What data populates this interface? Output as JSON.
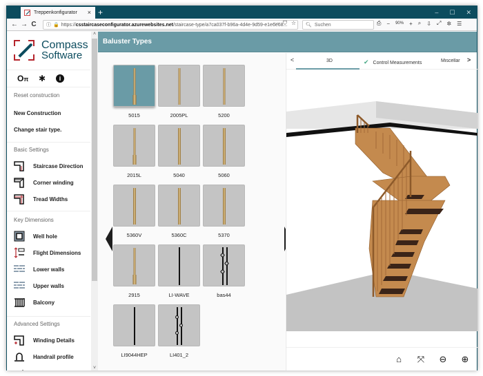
{
  "browser": {
    "tab_title": "Treppenkonfigurator",
    "tab_close": "×",
    "new_tab": "+",
    "window_controls": [
      "–",
      "☐",
      "✕"
    ],
    "nav": {
      "back": "←",
      "forward": "→",
      "reload": "C"
    },
    "url_host": "csstaircaseconfigurator.azurewebsites.net",
    "url_prefix": "https://",
    "url_path": "/staircase-type/a7ca037f-b96a-4d4e-9d59-e1e6e68...",
    "url_icons": [
      "···",
      "pocket-icon",
      "star-icon"
    ],
    "search_placeholder": "Suchen",
    "zoom_level": "90%",
    "toolbar_icons": [
      "print-icon",
      "zoom-out-icon",
      "zoom-in-icon",
      "magnify-icon",
      "download-icon",
      "fullscreen-icon",
      "settings-icon",
      "menu-icon"
    ]
  },
  "logo": {
    "line1": "Compass",
    "line2": "Software"
  },
  "sidebar": {
    "top_icons": [
      "key-icon",
      "gear-icon",
      "info-icon"
    ],
    "reset_header": "Reset construction",
    "reset_items": [
      "New Construction",
      "Change stair type."
    ],
    "basic_header": "Basic Settings",
    "basic_items": [
      "Staircase Direction",
      "Corner winding",
      "Tread Widths"
    ],
    "key_header": "Key Dimensions",
    "key_items": [
      "Well hole",
      "Flight Dimensions",
      "Lower walls",
      "Upper walls",
      "Balcony"
    ],
    "adv_header": "Advanced Settings",
    "adv_items": [
      "Winding Details",
      "Handrail profile"
    ]
  },
  "main": {
    "title": "Baluster Types",
    "selected": "5015",
    "balusters": [
      {
        "label": "5015",
        "style": "wood-turned-base"
      },
      {
        "label": "2005PL",
        "style": "wood-turned"
      },
      {
        "label": "5200",
        "style": "wood-turned"
      },
      {
        "label": "2015L",
        "style": "wood-turned-base"
      },
      {
        "label": "5040",
        "style": "wood-square"
      },
      {
        "label": "5060",
        "style": "wood-square"
      },
      {
        "label": "5360V",
        "style": "wood-square"
      },
      {
        "label": "5360C",
        "style": "wood-square"
      },
      {
        "label": "5370",
        "style": "wood-square"
      },
      {
        "label": "2915",
        "style": "wood-turned-base"
      },
      {
        "label": "LI-WAVE",
        "style": "iron-wave"
      },
      {
        "label": "bas44",
        "style": "iron-double-knots"
      },
      {
        "label": "LI9044HEP",
        "style": "iron-plain"
      },
      {
        "label": "LI401_2",
        "style": "iron-double-rings"
      }
    ]
  },
  "viewer": {
    "tabs": [
      {
        "label": "3D",
        "active": true
      },
      {
        "label": "Control Measurements",
        "checked": true
      },
      {
        "label": "Miscellar"
      }
    ],
    "prev": "<",
    "next": ">",
    "controls": [
      "home-icon",
      "fit-icon",
      "zoom-out-icon",
      "zoom-in-icon"
    ]
  },
  "colors": {
    "brand": "#0c4c5e",
    "accent": "#6a9ba6",
    "logo_red": "#b5242c",
    "check": "#4aaa88",
    "wood": "#c48a4e"
  }
}
